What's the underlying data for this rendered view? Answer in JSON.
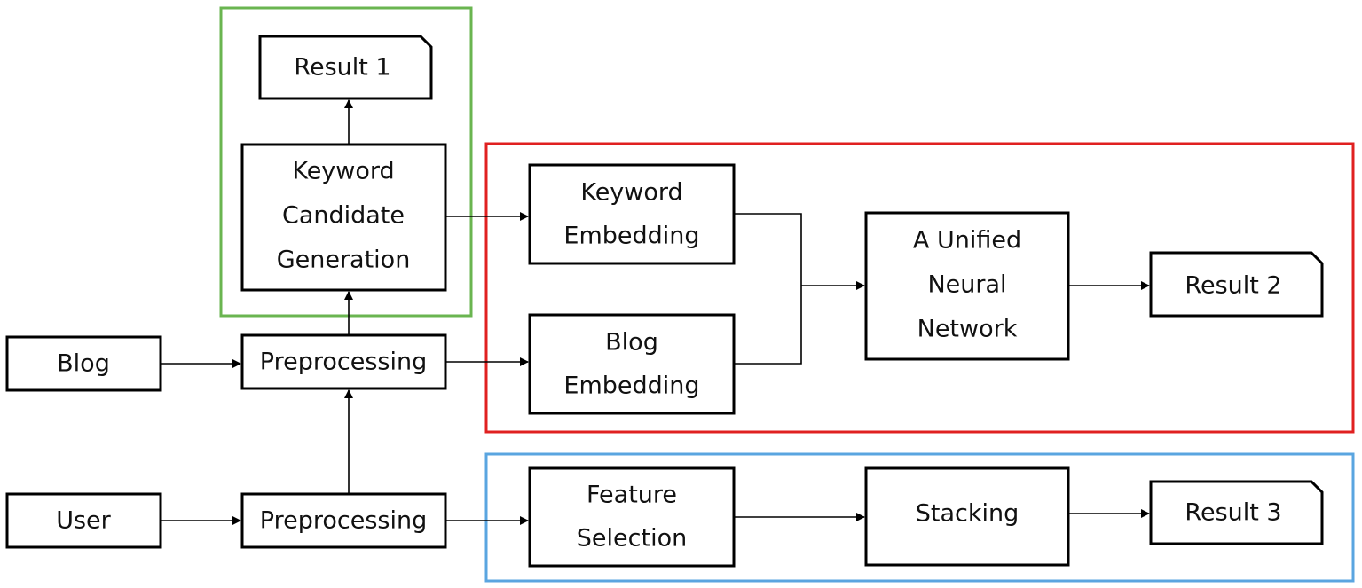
{
  "colors": {
    "group_keyword": "#6ab550",
    "group_embedding": "#e02020",
    "group_feature": "#5aa5e0"
  },
  "nodes": {
    "result1": "Result 1",
    "keyword_candidate": [
      "Keyword",
      "Candidate",
      "Generation"
    ],
    "blog": "Blog",
    "user": "User",
    "preprocessing_blog": "Preprocessing",
    "preprocessing_user": "Preprocessing",
    "keyword_embedding": [
      "Keyword",
      "Embedding"
    ],
    "blog_embedding": [
      "Blog",
      "Embedding"
    ],
    "unified_nn": [
      "A Unified",
      "Neural",
      "Network"
    ],
    "result2": "Result 2",
    "feature_selection": [
      "Feature",
      "Selection"
    ],
    "stacking": "Stacking",
    "result3": "Result 3"
  }
}
